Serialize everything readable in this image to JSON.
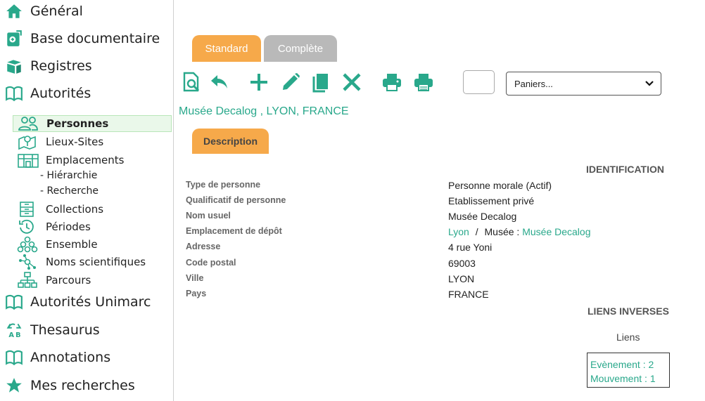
{
  "sidebar": {
    "main_items": [
      {
        "label": "Général",
        "icon": "home-icon"
      },
      {
        "label": "Base documentaire",
        "icon": "book-add-icon"
      },
      {
        "label": "Registres",
        "icon": "books-icon"
      },
      {
        "label": "Autorités",
        "icon": "open-book-icon"
      }
    ],
    "sub_items": [
      {
        "label": "Personnes",
        "icon": "people-icon"
      },
      {
        "label": "Lieux-Sites",
        "icon": "map-pin-icon"
      },
      {
        "label": "Emplacements",
        "icon": "buildings-icon"
      }
    ],
    "subsub_items": [
      {
        "label": "- Hiérarchie"
      },
      {
        "label": "- Recherche"
      }
    ],
    "sub_items_2": [
      {
        "label": "Collections",
        "icon": "archive-icon"
      },
      {
        "label": "Périodes",
        "icon": "history-icon"
      },
      {
        "label": "Ensemble",
        "icon": "group-icon"
      },
      {
        "label": "Noms scientifiques",
        "icon": "network-icon"
      },
      {
        "label": "Parcours",
        "icon": "sitemap-icon"
      }
    ],
    "main_items_2": [
      {
        "label": "Autorités Unimarc",
        "icon": "open-book-icon"
      },
      {
        "label": "Thesaurus",
        "icon": "recycle-icon"
      },
      {
        "label": "Annotations",
        "icon": "open-book-icon"
      },
      {
        "label": "Mes recherches",
        "icon": "star-icon"
      }
    ]
  },
  "tabs": {
    "standard": "Standard",
    "complete": "Complète"
  },
  "toolbar": {
    "paniers": "Paniers..."
  },
  "record": {
    "title": "Musée Decalog , LYON, FRANCE",
    "description_tab": "Description"
  },
  "identification": {
    "title": "IDENTIFICATION",
    "fields": [
      {
        "label": "Type de personne",
        "value": "Personne morale (Actif)"
      },
      {
        "label": "Qualificatif de personne",
        "value": "Etablissement privé"
      },
      {
        "label": "Nom usuel",
        "value": "Musée Decalog"
      },
      {
        "label": "Emplacement de dépôt",
        "value": ""
      },
      {
        "label": "Adresse",
        "value": "4 rue Yoni"
      },
      {
        "label": "Code postal",
        "value": "69003"
      },
      {
        "label": "Ville",
        "value": "LYON"
      },
      {
        "label": "Pays",
        "value": "FRANCE"
      }
    ],
    "emplacement": {
      "link1": "Lyon",
      "sep": "/",
      "prefix": "Musée :",
      "link2": "Musée Decalog"
    }
  },
  "liens_inverses": {
    "title": "LIENS INVERSES",
    "label": "Liens",
    "items": [
      "Evènement : 2",
      "Mouvement : 1"
    ]
  },
  "colors": {
    "accent": "#29a88b",
    "tab_active": "#f6a94a",
    "tab_inactive": "#b9b9b9"
  }
}
